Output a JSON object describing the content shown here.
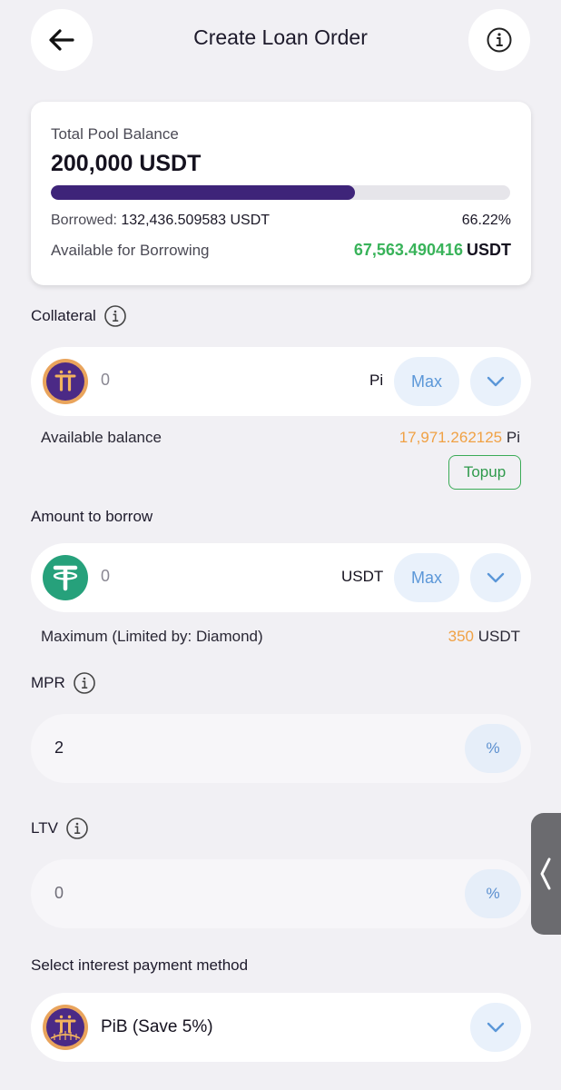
{
  "header": {
    "title": "Create Loan Order"
  },
  "pool": {
    "title": "Total Pool Balance",
    "amount": "200,000 USDT",
    "progress_fraction": 0.6622,
    "borrowed_label": "Borrowed:",
    "borrowed_value": "132,436.509583 USDT",
    "borrowed_percent": "66.22%",
    "available_label": "Available for Borrowing",
    "available_value": "67,563.490416",
    "available_unit": "USDT"
  },
  "collateral": {
    "label": "Collateral",
    "value": "0",
    "unit": "Pi",
    "max_label": "Max",
    "balance_label": "Available balance",
    "balance_value": "17,971.262125",
    "balance_unit": "Pi",
    "topup_label": "Topup"
  },
  "borrow": {
    "label": "Amount to borrow",
    "value": "0",
    "unit": "USDT",
    "max_label": "Max",
    "limit_label": "Maximum (Limited by: Diamond)",
    "limit_value": "350",
    "limit_unit": "USDT"
  },
  "mpr": {
    "label": "MPR",
    "value": "2",
    "unit": "%"
  },
  "ltv": {
    "label": "LTV",
    "value": "0",
    "unit": "%"
  },
  "payment": {
    "label": "Select interest payment method",
    "selected": "PiB (Save 5%)"
  },
  "colors": {
    "accent_purple": "#3e2479",
    "green": "#39b35a",
    "orange": "#f0a144",
    "blue": "#5b97d8",
    "tether": "#26a17b"
  },
  "icons": {
    "back": "arrow-left-icon",
    "info": "info-icon",
    "chevron": "chevron-down-icon",
    "pi": "pi-coin-icon",
    "tether": "tether-icon",
    "handle": "chevron-left-icon"
  }
}
